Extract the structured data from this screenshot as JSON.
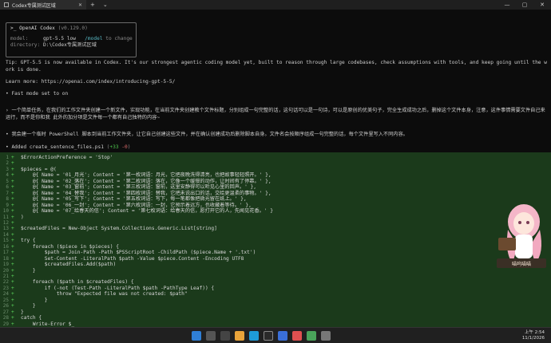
{
  "window": {
    "tab_title": "Codex专属测试区域"
  },
  "banner": {
    "title": ">_ OpenAI Codex ",
    "version": "(v0.129.0)",
    "model_key": "model:",
    "model_val": "gpt-5.5 low",
    "model_hint_cmd": "/model",
    "model_hint": " to change",
    "dir_key": "directory:",
    "dir_val": "D:\\Codex专属测试区域"
  },
  "tip": "Tip: GPT-5.5 is now available in Codex. It's our strongest agentic coding model yet, built to reason through large codebases, check assumptions with tools, and keep going until the work is done.",
  "learn_more": "Learn more: https://openai.com/index/introducing-gpt-5-5/",
  "fast_mode": "• Fast mode set to on",
  "prompt1": "› 一个简单任务，在我们的工作文件夹创建一个新文件，实现功能，在当前文件夹创建教个文件标题，分别组成一句完整的话，这句话可以是一句诗，可以是原创的优美句子，完全生成成功之后，删掉这个文件本身，注意，这件事情需要文件自己来运行，而不是你和我 此外的加分项是文件每一个都有自己独特的内容~",
  "status": "• 我会建一个临时 PowerShell 脚本到当前工作文件夹，让它自己创建这些文件，并在确认创建成功后删除脚本自身。文件名会按顺序组成一句完整的话，每个文件里写入不同内容。",
  "added": {
    "prefix": "• Added ",
    "file": "create_sentence_files.ps1 ",
    "stat_open": "(",
    "plus": "+33",
    "minus": "-0",
    "stat_close": ")"
  },
  "diff_lines": [
    {
      "n": "1",
      "t": "$ErrorActionPreference = 'Stop'"
    },
    {
      "n": "2",
      "t": ""
    },
    {
      "n": "3",
      "t": "$pieces = @("
    },
    {
      "n": "4",
      "t": "    @{ Name = '01_月光'; Content = '第一枚词语：月光，它把夜晚洗得清亮，也把故事轻轻照开。' },"
    },
    {
      "n": "5",
      "t": "    @{ Name = '02_落在'; Content = '第二枚词语：落在，它像一个缓慢的动作，让时间有了停靠。' },"
    },
    {
      "n": "6",
      "t": "    @{ Name = '03_窗前'; Content = '第三枚词语：窗前，这里安静得可以听见心里的回声。' },"
    },
    {
      "n": "7",
      "t": "    @{ Name = '04_替我'; Content = '第四枚词语：替我，它把未说出口的话，交给更温柔的事物。' },"
    },
    {
      "n": "8",
      "t": "    @{ Name = '05_写下'; Content = '第五枚词语：写下，每一笔都像把微光留在纸上。' },"
    },
    {
      "n": "9",
      "t": "    @{ Name = '06_一封'; Content = '第六枚词语：一封，它预示着远方，也收藏着等待。' },"
    },
    {
      "n": "10",
      "t": "    @{ Name = '07_给春天的信'; Content = '第七枚词语：给春天的信，愿打开它的人，先闻见花香。' }"
    },
    {
      "n": "11",
      "t": ")"
    },
    {
      "n": "12",
      "t": ""
    },
    {
      "n": "13",
      "t": "$createdFiles = New-Object System.Collections.Generic.List[string]"
    },
    {
      "n": "14",
      "t": ""
    },
    {
      "n": "15",
      "t": "try {"
    },
    {
      "n": "16",
      "t": "    foreach ($piece in $pieces) {"
    },
    {
      "n": "17",
      "t": "        $path = Join-Path -Path $PSScriptRoot -ChildPath ($piece.Name + '.txt')"
    },
    {
      "n": "18",
      "t": "        Set-Content -LiteralPath $path -Value $piece.Content -Encoding UTF8"
    },
    {
      "n": "19",
      "t": "        $createdFiles.Add($path)"
    },
    {
      "n": "20",
      "t": "    }"
    },
    {
      "n": "21",
      "t": ""
    },
    {
      "n": "22",
      "t": "    foreach ($path in $createdFiles) {"
    },
    {
      "n": "23",
      "t": "        if (-not (Test-Path -LiteralPath $path -PathType Leaf)) {"
    },
    {
      "n": "24",
      "t": "            throw \"Expected file was not created: $path\""
    },
    {
      "n": "25",
      "t": "        }"
    },
    {
      "n": "26",
      "t": "    }"
    },
    {
      "n": "27",
      "t": "}"
    },
    {
      "n": "28",
      "t": "catch {"
    },
    {
      "n": "29",
      "t": "    Write-Error $_"
    }
  ],
  "plus_sign": "+",
  "mascot_caption": "喵呜喵喵",
  "tray": {
    "time": "上午 2:54",
    "date": "11/1/2026"
  },
  "colors": {
    "diff_bg": "#1b3a1b",
    "accent_green": "#4ec94e",
    "accent_red": "#e06c6c",
    "terminal_bg": "#0c0c0c"
  }
}
